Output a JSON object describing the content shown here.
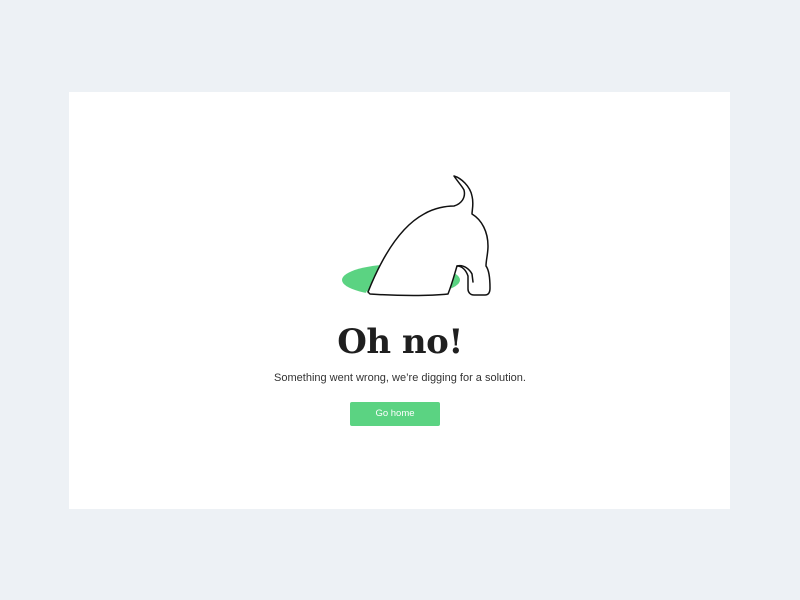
{
  "error": {
    "title": "Oh no!",
    "message": "Something went wrong, we’re digging for a solution.",
    "home_button_label": "Go home"
  },
  "illustration": {
    "icon": "dog-digging-hole-icon",
    "hole_color": "#5bd382",
    "outline_color": "#111111"
  },
  "colors": {
    "background": "#edf1f5",
    "card": "#ffffff",
    "accent": "#5bd382"
  }
}
